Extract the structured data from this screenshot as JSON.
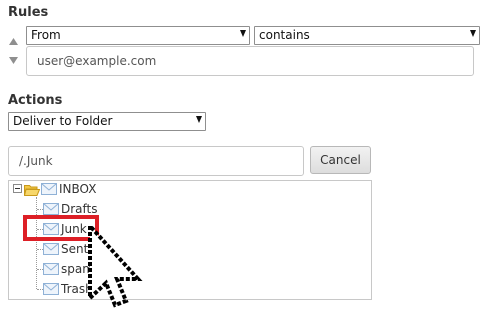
{
  "rules": {
    "heading": "Rules",
    "field_select": "From",
    "operator_select": "contains",
    "value": "user@example.com"
  },
  "actions": {
    "heading": "Actions",
    "action_select": "Deliver to Folder",
    "folder_path": "/.Junk",
    "cancel_label": "Cancel"
  },
  "folder_tree": {
    "root": "INBOX",
    "children": [
      "Drafts",
      "Junk",
      "Sent",
      "spam",
      "Trash"
    ],
    "highlighted": "Junk"
  },
  "colors": {
    "highlight_border": "#dd1f26",
    "folder_yellow": "#f3c846",
    "mail_blue": "#8fb1d6"
  },
  "icons": [
    "move-up-icon",
    "move-down-icon",
    "chevron-down-icon",
    "collapse-icon",
    "folder-open-icon",
    "mail-folder-icon",
    "mouse-cursor-icon"
  ]
}
